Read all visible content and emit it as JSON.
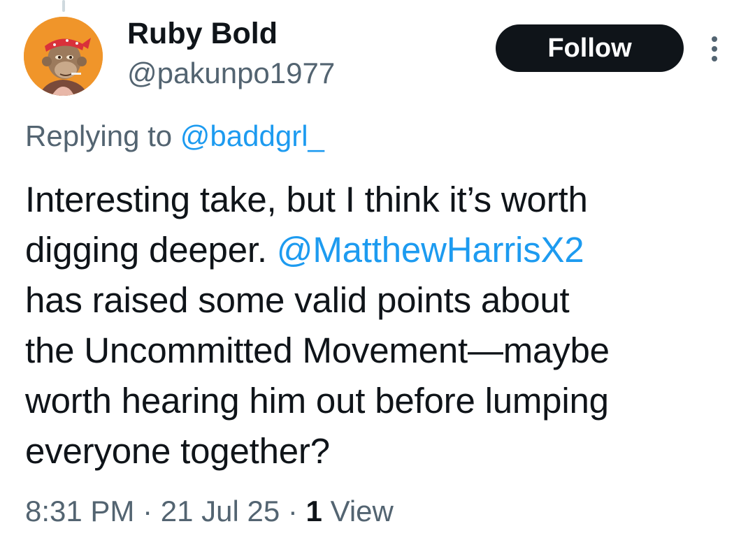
{
  "tweet": {
    "author": {
      "display_name": "Ruby Bold",
      "handle": "@pakunpo1977",
      "avatar_icon": "ape-avatar-icon"
    },
    "follow_label": "Follow",
    "more_icon": "more-options-icon",
    "reply_context": {
      "prefix": "Replying to ",
      "mention": "@baddgrl_"
    },
    "body": {
      "line1": "Interesting take, but I think it’s worth",
      "line2_text": "digging deeper. ",
      "line2_mention": "@MatthewHarrisX2",
      "line3": "has raised some valid points about",
      "line4": "the Uncommitted Movement—maybe",
      "line5": "worth hearing him out before lumping",
      "line6": "everyone together?"
    },
    "meta": {
      "time": "8:31 PM",
      "separator": " · ",
      "date": "21 Jul 25",
      "views_count": "1",
      "views_label": "View"
    }
  },
  "colors": {
    "link": "#1d9bf0",
    "secondary_text": "#536471",
    "primary_text": "#0f1419",
    "follow_button_bg": "#0f1419",
    "avatar_bg": "#f0952a"
  }
}
